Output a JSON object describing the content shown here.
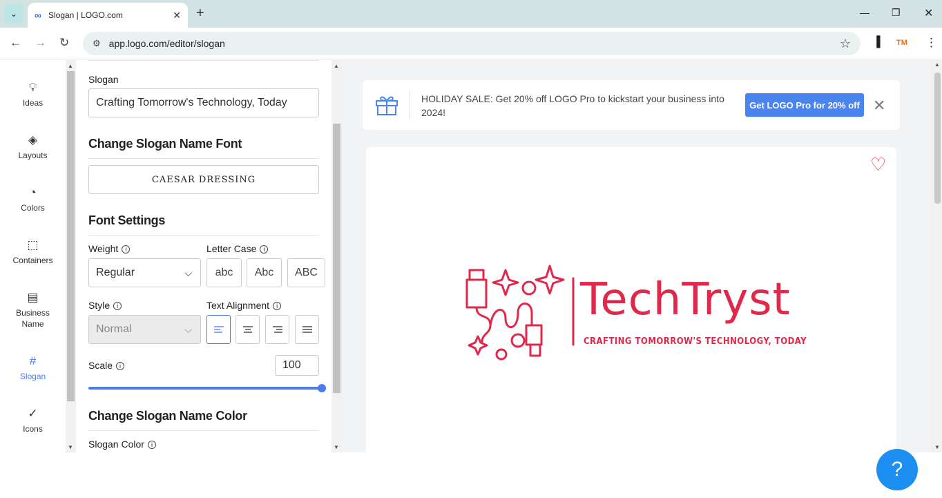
{
  "browser": {
    "tab_title": "Slogan | LOGO.com",
    "url": "app.logo.com/editor/slogan",
    "profile": "TM"
  },
  "sidebar": {
    "items": [
      {
        "label": "Ideas",
        "icon": "lightbulb-icon"
      },
      {
        "label": "Layouts",
        "icon": "layers-icon"
      },
      {
        "label": "Colors",
        "icon": "palette-icon"
      },
      {
        "label": "Containers",
        "icon": "container-icon"
      },
      {
        "label": "Business Name",
        "icon": "id-card-icon"
      },
      {
        "label": "Slogan",
        "icon": "hash-icon",
        "active": true
      },
      {
        "label": "Icons",
        "icon": "check-circle-icon"
      }
    ]
  },
  "panel": {
    "slogan_label": "Slogan",
    "slogan_value": "Crafting Tomorrow's Technology, Today",
    "font_heading": "Change Slogan Name Font",
    "font_name": "CAESAR DRESSING",
    "settings_heading": "Font Settings",
    "weight_label": "Weight",
    "weight_value": "Regular",
    "case_label": "Letter Case",
    "case_options": [
      "abc",
      "Abc",
      "ABC"
    ],
    "style_label": "Style",
    "style_value": "Normal",
    "align_label": "Text Alignment",
    "scale_label": "Scale",
    "scale_value": "100",
    "scale_fraction": 1.0,
    "color_heading": "Change Slogan Name Color",
    "color_label": "Slogan Color"
  },
  "preview": {
    "banner_text": "HOLIDAY SALE: Get 20% off LOGO Pro to kickstart your business into 2024!",
    "banner_cta": "Get LOGO Pro for 20% off",
    "brand_name": "TechTryst",
    "tagline": "CRAFTING TOMORROW'S TECHNOLOGY, TODAY",
    "brand_color": "#e0284a"
  },
  "help_label": "?"
}
